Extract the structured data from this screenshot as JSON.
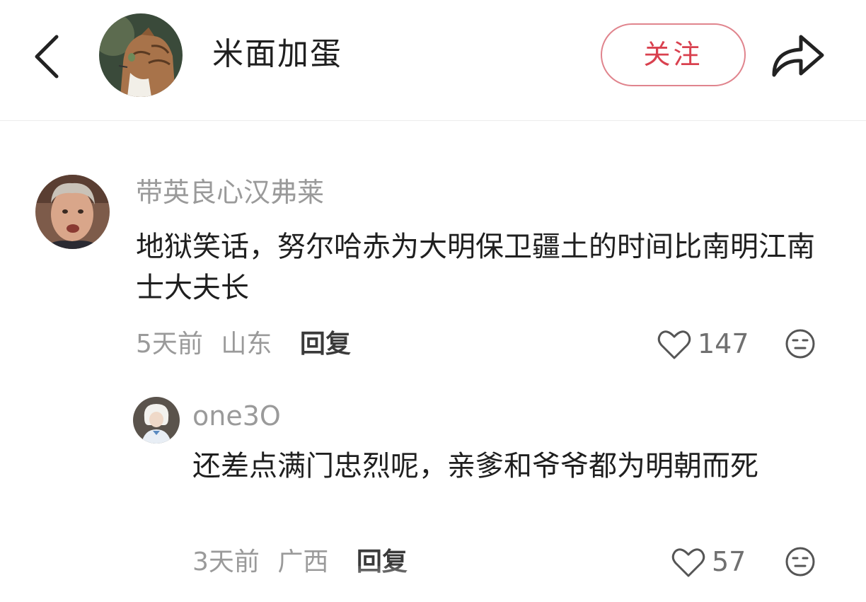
{
  "header": {
    "author_name": "米面加蛋",
    "follow_label": "关注",
    "icons": [
      "chevron-left-icon",
      "share-arrow-icon"
    ]
  },
  "comments": [
    {
      "username": "带英良心汉弗莱",
      "text": "地狱笑话，努尔哈赤为大明保卫疆土的时间比南明江南士大夫长",
      "time": "5天前",
      "location": "山东",
      "reply_label": "回复",
      "likes": "147"
    },
    {
      "username": "one3O",
      "text": "还差点满门忠烈呢，亲爹和爷爷都为明朝而死",
      "time": "3天前",
      "location": "广西",
      "reply_label": "回复",
      "likes": "57"
    }
  ],
  "colors": {
    "accent": "#d9414f",
    "follow_border": "#e0848d",
    "secondary_text": "#9a9a9a",
    "primary_text": "#1f1f1f"
  }
}
